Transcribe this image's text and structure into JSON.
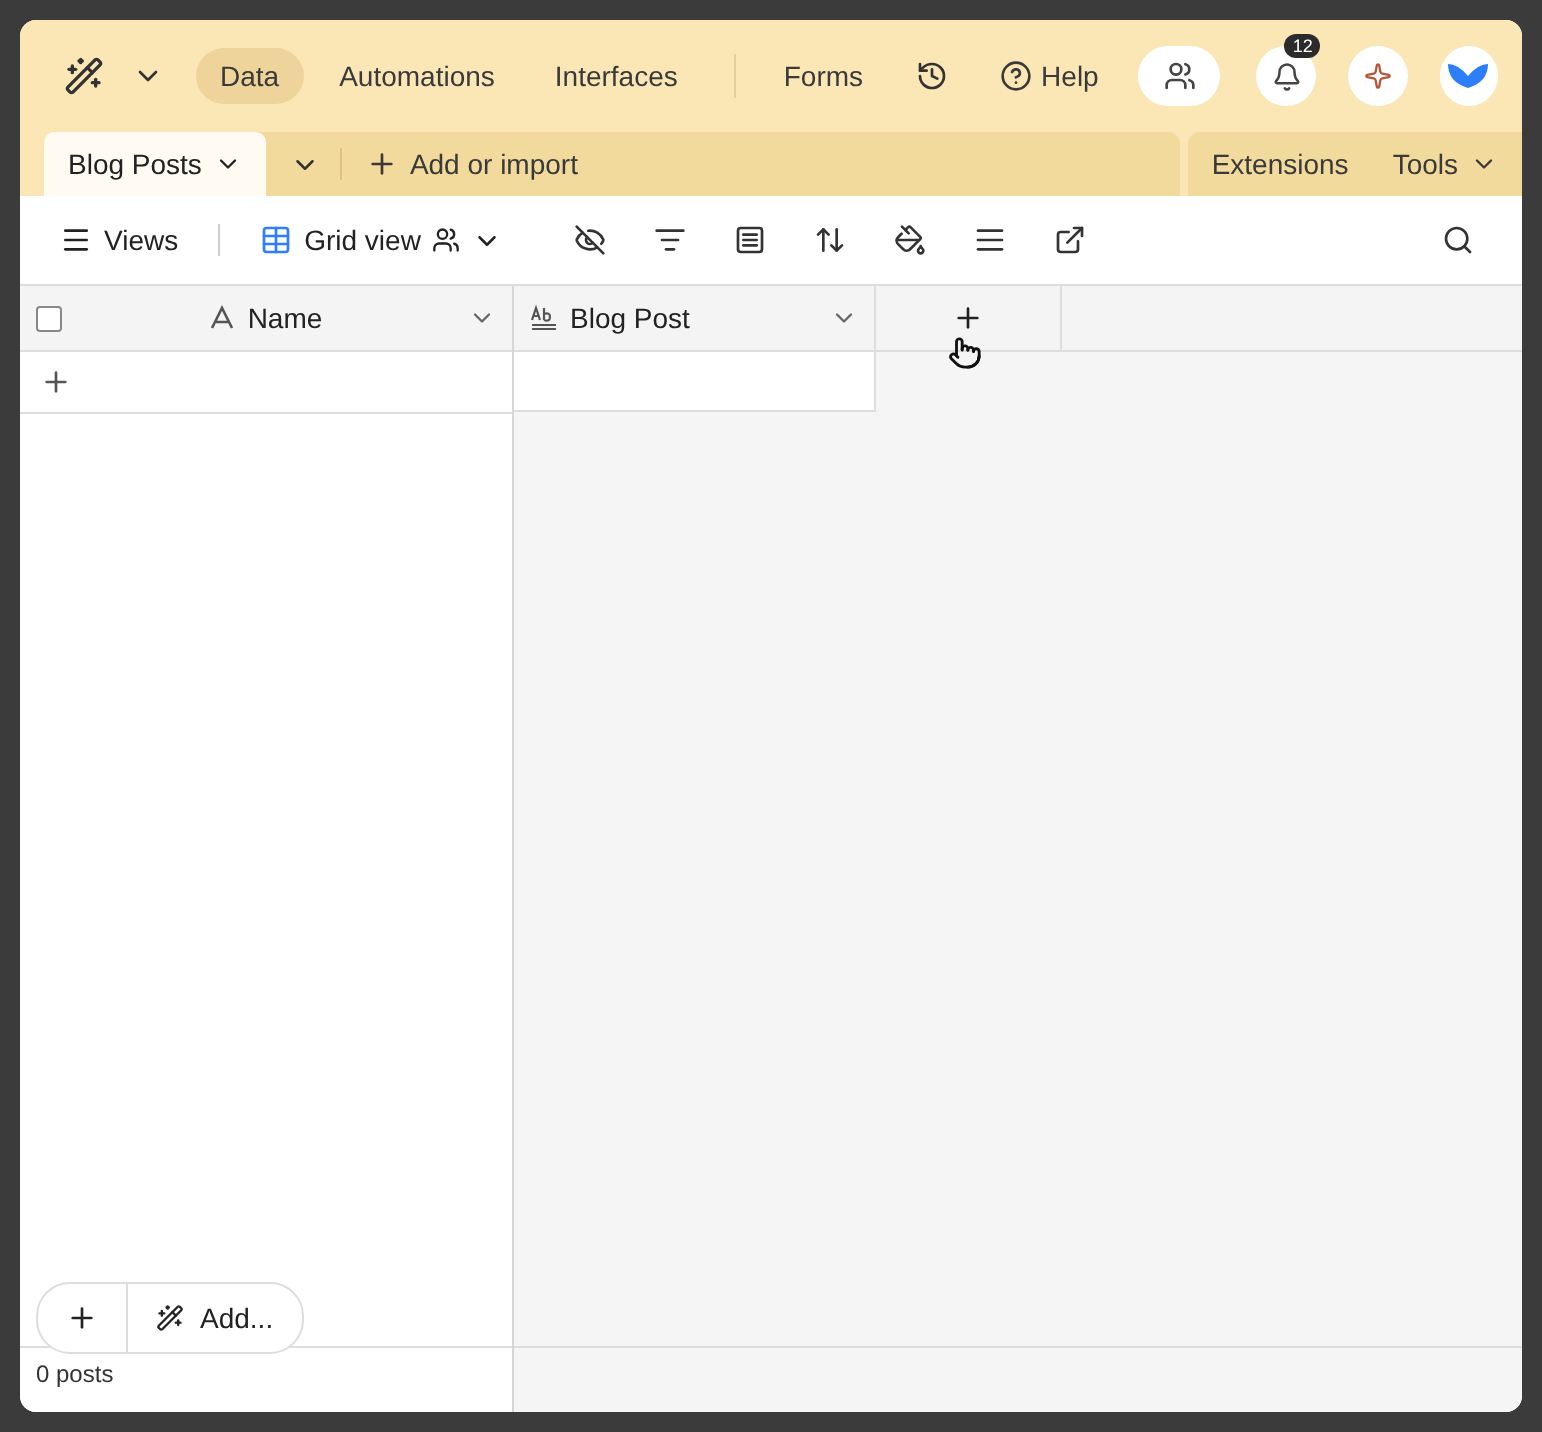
{
  "top_nav": {
    "tabs": [
      {
        "label": "Data",
        "selected": true
      },
      {
        "label": "Automations",
        "selected": false
      },
      {
        "label": "Interfaces",
        "selected": false
      }
    ],
    "forms": "Forms",
    "help": "Help",
    "notification_count": "12"
  },
  "table_tabs": {
    "tabs": [
      {
        "label": "Blog Posts",
        "selected": true
      }
    ],
    "add": "Add or import",
    "extensions": "Extensions",
    "tools": "Tools"
  },
  "view_bar": {
    "views": "Views",
    "view_name": "Grid view"
  },
  "grid": {
    "select_all_checked": false,
    "columns": [
      {
        "label": "Name",
        "kind": "primary"
      },
      {
        "label": "Blog Post",
        "kind": "long_text"
      }
    ]
  },
  "footer": {
    "add_label": "Add...",
    "record_count": "0 posts"
  }
}
